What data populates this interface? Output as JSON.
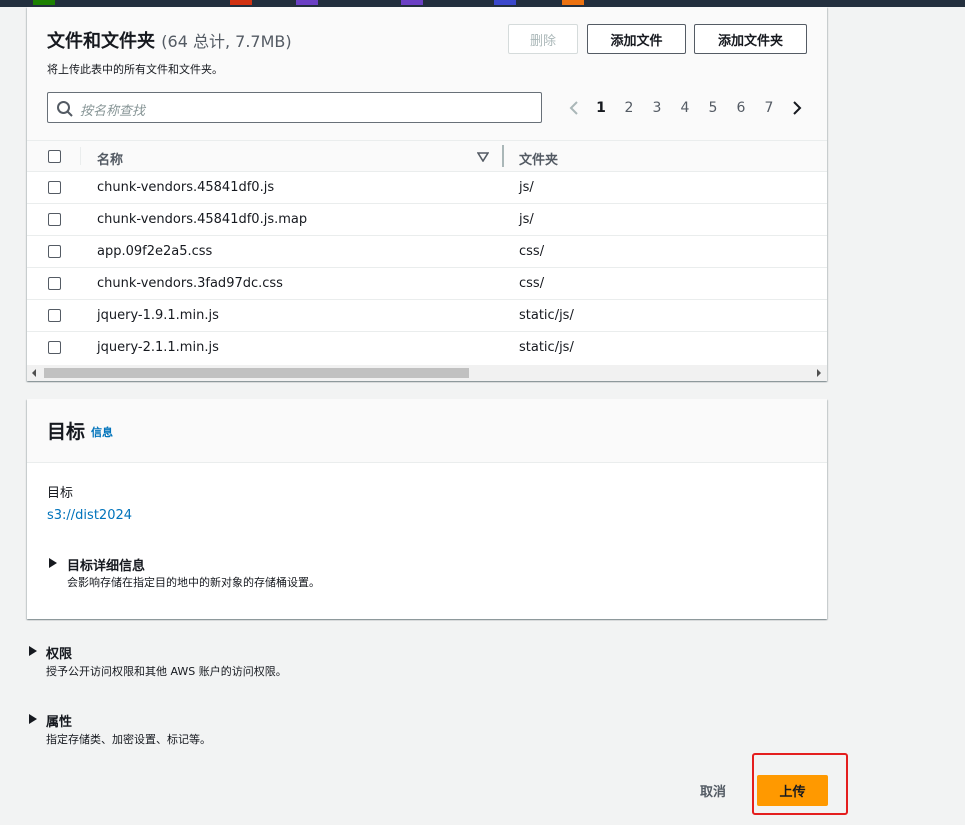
{
  "colors": {
    "accent": "#ff9900",
    "link": "#0073bb",
    "highlight": "#e41e1e",
    "topbar": "#232f3e"
  },
  "files": {
    "title": "文件和文件夹",
    "count": "(64 总计, 7.7MB)",
    "description": "将上传此表中的所有文件和文件夹。",
    "remove_label": "删除",
    "add_files_label": "添加文件",
    "add_folder_label": "添加文件夹",
    "search_placeholder": "按名称查找",
    "pages": [
      "1",
      "2",
      "3",
      "4",
      "5",
      "6",
      "7"
    ],
    "current_page": "1",
    "columns": {
      "name": "名称",
      "folder": "文件夹"
    },
    "rows": [
      {
        "name": "chunk-vendors.45841df0.js",
        "folder": "js/"
      },
      {
        "name": "chunk-vendors.45841df0.js.map",
        "folder": "js/"
      },
      {
        "name": "app.09f2e2a5.css",
        "folder": "css/"
      },
      {
        "name": "chunk-vendors.3fad97dc.css",
        "folder": "css/"
      },
      {
        "name": "jquery-1.9.1.min.js",
        "folder": "static/js/"
      },
      {
        "name": "jquery-2.1.1.min.js",
        "folder": "static/js/"
      }
    ]
  },
  "destination": {
    "title": "目标",
    "info_link": "信息",
    "field_label": "目标",
    "target_value": "s3://dist2024",
    "details_title": "目标详细信息",
    "details_desc": "会影响存储在指定目的地中的新对象的存储桶设置。"
  },
  "permissions": {
    "title": "权限",
    "desc": "授予公开访问权限和其他 AWS 账户的访问权限。"
  },
  "properties": {
    "title": "属性",
    "desc": "指定存储类、加密设置、标记等。"
  },
  "actions": {
    "cancel_label": "取消",
    "upload_label": "上传"
  }
}
